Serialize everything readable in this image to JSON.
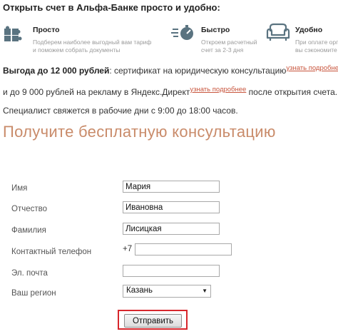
{
  "header": {
    "title": "Открыть счет в Альфа-Банке просто и удобно:"
  },
  "features": [
    {
      "icon": "puzzle-icon",
      "title": "Просто",
      "desc1": "Подберем наиболее выгодный вам тариф",
      "desc2": "и поможем собрать документы"
    },
    {
      "icon": "stopwatch-icon",
      "title": "Быстро",
      "desc1": "Откроем расчетный",
      "desc2": "счет за 2-3 дня"
    },
    {
      "icon": "armchair-icon",
      "title": "Удобно",
      "desc1": "При оплате орга",
      "desc2": "вы сэкономите"
    }
  ],
  "promo": {
    "line1_bold": "Выгода до 12 000 рублей",
    "line1_text": ": сертификат на юридическую консультацию",
    "line1_link": "узнать подробнее",
    "line2_text_a": "и до 9 000 рублей на рекламу в Яндекс.Директ",
    "line2_link": "узнать подробнее",
    "line2_text_b": " после открытия счета."
  },
  "contact_hours": "Специалист свяжется в рабочие дни с 9:00 до 18:00 часов.",
  "consult_title": "Получите бесплатную консультацию",
  "form": {
    "name_label": "Имя",
    "name_value": "Мария",
    "patronymic_label": "Отчество",
    "patronymic_value": "Ивановна",
    "surname_label": "Фамилия",
    "surname_value": "Лисицкая",
    "phone_label": "Контактный телефон",
    "phone_prefix": "+7",
    "phone_value": "",
    "email_label": "Эл. почта",
    "email_value": "",
    "region_label": "Ваш регион",
    "region_value": "Казань",
    "submit_label": "Отправить"
  },
  "colors": {
    "accent_link": "#c8553d",
    "highlight": "#d7262c",
    "title_orange": "#c98b6a"
  }
}
